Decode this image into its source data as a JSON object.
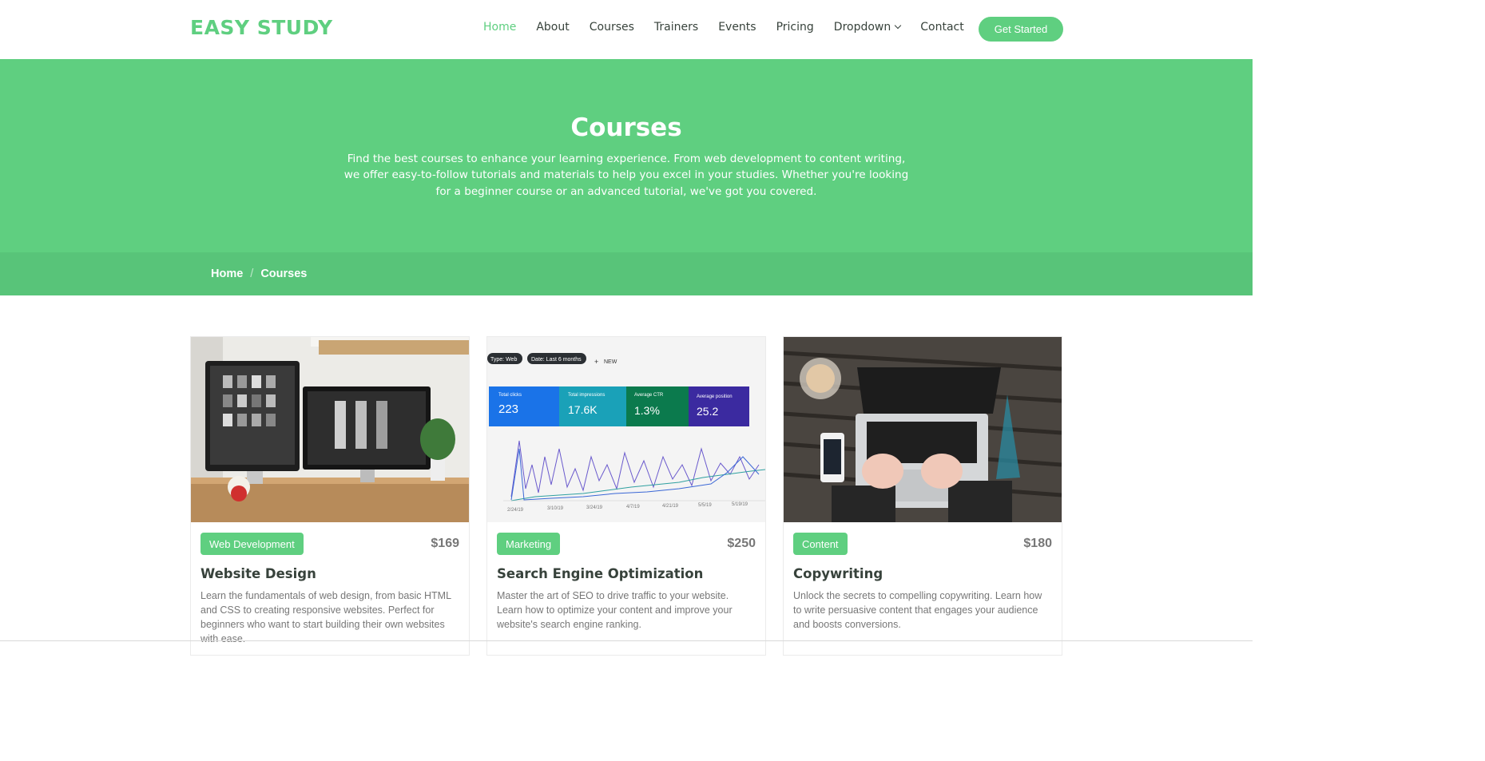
{
  "header": {
    "logo": "EASY STUDY",
    "nav": [
      {
        "label": "Home",
        "active": true
      },
      {
        "label": "About"
      },
      {
        "label": "Courses"
      },
      {
        "label": "Trainers"
      },
      {
        "label": "Events"
      },
      {
        "label": "Pricing"
      },
      {
        "label": "Dropdown"
      },
      {
        "label": "Contact"
      }
    ],
    "cta": "Get Started"
  },
  "hero": {
    "title": "Courses",
    "text": "Find the best courses to enhance your learning experience. From web development to content writing, we offer easy-to-follow tutorials and materials to help you excel in your studies. Whether you're looking for a beginner course or an advanced tutorial, we've got you covered."
  },
  "breadcrumb": {
    "home": "Home",
    "separator": "/",
    "current": "Courses"
  },
  "courses": [
    {
      "category": "Web Development",
      "price": "$169",
      "title": "Website Design",
      "description": "Learn the fundamentals of web design, from basic HTML and CSS to creating responsive websites. Perfect for beginners who want to start building their own websites with ease."
    },
    {
      "category": "Marketing",
      "price": "$250",
      "title": "Search Engine Optimization",
      "description": "Master the art of SEO to drive traffic to your website. Learn how to optimize your content and improve your website's search engine ranking."
    },
    {
      "category": "Content",
      "price": "$180",
      "title": "Copywriting",
      "description": "Unlock the secrets to compelling copywriting. Learn how to write persuasive content that engages your audience and boosts conversions."
    }
  ],
  "seo_image": {
    "chips": [
      "Type: Web",
      "Date: Last 6 months",
      "NEW"
    ],
    "metrics": [
      {
        "label": "Total clicks",
        "value": "223",
        "color": "#1a73e8"
      },
      {
        "label": "Total impressions",
        "value": "17.6K",
        "color": "#1aa1b8"
      },
      {
        "label": "Average CTR",
        "value": "1.3%",
        "color": "#0b7a4d"
      },
      {
        "label": "Average position",
        "value": "25.2",
        "color": "#3b2aa0"
      }
    ],
    "dates": [
      "2/24/19",
      "3/10/19",
      "3/24/19",
      "4/7/19",
      "4/21/19",
      "5/5/19",
      "5/19/19"
    ]
  },
  "colors": {
    "accent": "#5fcf80",
    "breadcrumb_bg": "#58c479"
  }
}
